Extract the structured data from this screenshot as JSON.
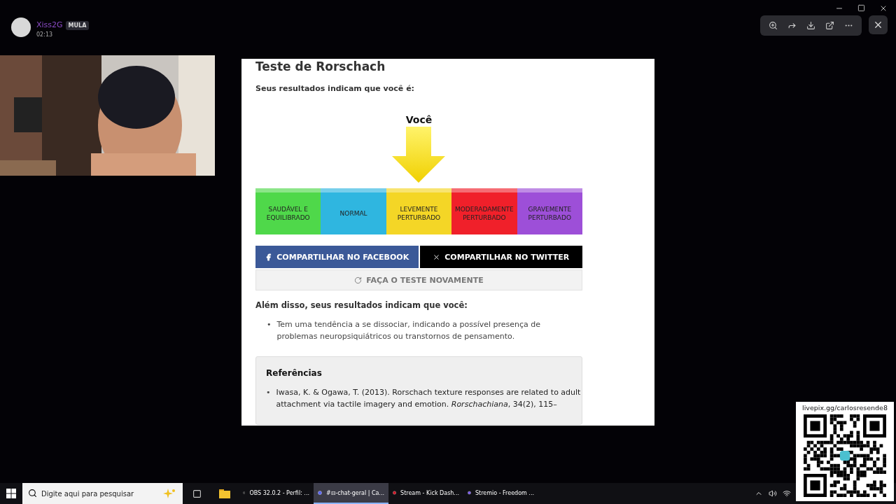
{
  "post": {
    "author": "Xiss2G",
    "badge": "MULA",
    "time": "02:13"
  },
  "viewer_toolbar": {
    "tools": [
      {
        "kind": "zoom"
      },
      {
        "kind": "forward"
      },
      {
        "kind": "download"
      },
      {
        "kind": "open"
      },
      {
        "kind": "more"
      }
    ]
  },
  "result_page": {
    "title": "Teste de Rorschach",
    "intro": "Seus resultados indicam que você é:",
    "marker_label": "Você",
    "scale": [
      {
        "label": "SAUDÁVEL E EQUILIBRADO",
        "color": "#4fd84a",
        "selected": false
      },
      {
        "label": "NORMAL",
        "color": "#2fb6e0",
        "selected": false
      },
      {
        "label": "LEVEMENTE PERTURBADO",
        "color": "#f4d626",
        "selected": true
      },
      {
        "label": "MODERADAMENTE PERTURBADO",
        "color": "#f0202a",
        "selected": false
      },
      {
        "label": "GRAVEMENTE PERTURBADO",
        "color": "#9d4fd8",
        "selected": false
      }
    ],
    "share_facebook": "COMPARTILHAR NO FACEBOOK",
    "share_twitter": "COMPARTILHAR NO TWITTER",
    "retry": "FAÇA O TESTE NOVAMENTE",
    "more_heading": "Além disso, seus resultados indicam que você:",
    "bullet": "•",
    "findings": [
      "Tem uma tendência a se dissociar, indicando a possível presença de problemas neuropsiquiátricos ou transtornos de pensamento."
    ],
    "references_heading": "Referências",
    "references": [
      "Iwasa, K. & Ogawa, T. (2013). Rorschach texture responses are related to adult attachment via tactile imagery and emotion. *Rorschachiana*, 34(2), 115–"
    ]
  },
  "qr_panel": {
    "url": "livepix.gg/carlosresende8"
  },
  "taskbar": {
    "search_placeholder": "Digite aqui para pesquisar",
    "apps": [
      {
        "kind": "obs",
        "label": "OBS 32.0.2 - Perfil: ...",
        "selected": false
      },
      {
        "kind": "discord",
        "label": "#⊟-chat-geral | Ca...",
        "selected": true
      },
      {
        "kind": "opera",
        "label": "Stream - Kick Dash...",
        "selected": false
      },
      {
        "kind": "stremio",
        "label": "Stremio - Freedom ...",
        "selected": false
      }
    ]
  }
}
